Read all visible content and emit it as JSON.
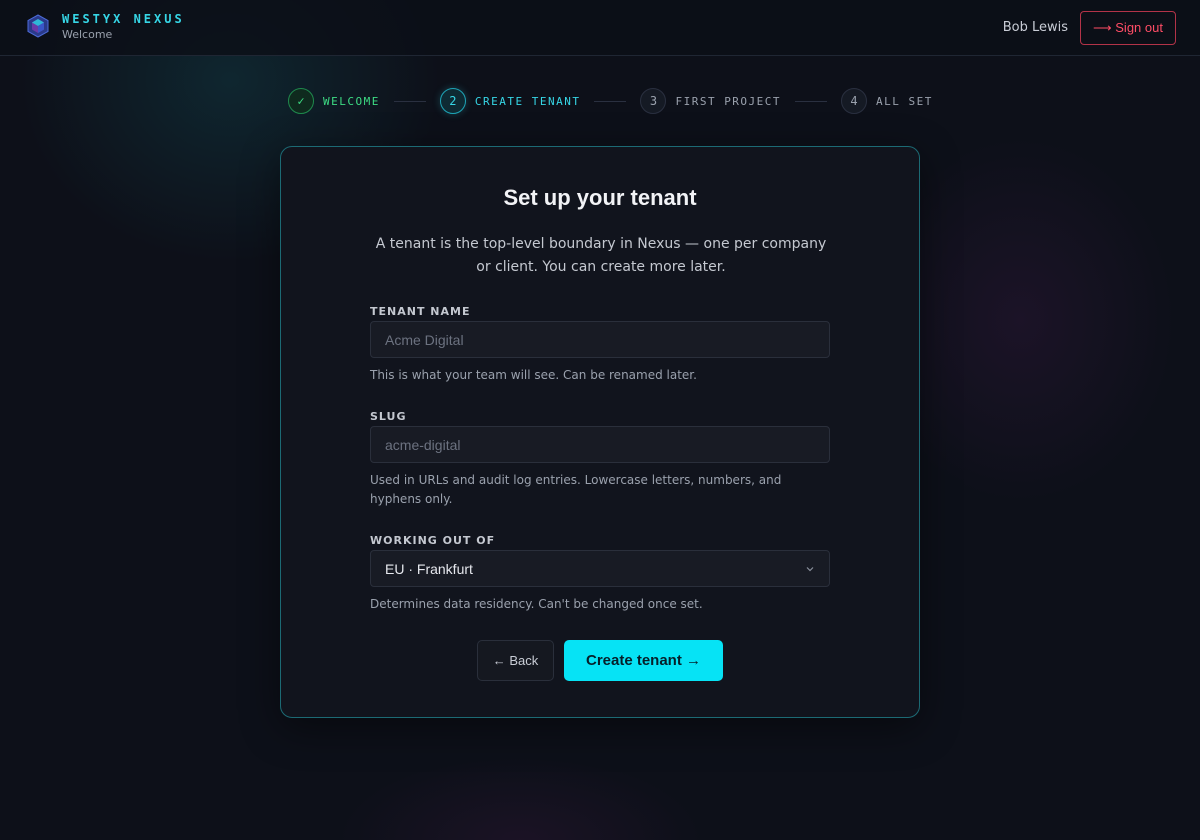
{
  "header": {
    "brand_name": "WESTYX NEXUS",
    "brand_sub": "Welcome",
    "user_name": "Bob Lewis",
    "sign_out_label": "⟶ Sign out"
  },
  "stepper": {
    "steps": [
      {
        "number": "✓",
        "label": "WELCOME",
        "state": "done"
      },
      {
        "number": "2",
        "label": "CREATE TENANT",
        "state": "active"
      },
      {
        "number": "3",
        "label": "FIRST PROJECT",
        "state": "pending"
      },
      {
        "number": "4",
        "label": "ALL SET",
        "state": "pending"
      }
    ]
  },
  "form": {
    "title": "Set up your tenant",
    "description": "A tenant is the top-level boundary in Nexus — one per company or client. You can create more later.",
    "tenant_name": {
      "label": "TENANT NAME",
      "value": "",
      "placeholder": "Acme Digital",
      "help": "This is what your team will see. Can be renamed later."
    },
    "slug": {
      "label": "SLUG",
      "value": "",
      "placeholder": "acme-digital",
      "help": "Used in URLs and audit log entries. Lowercase letters, numbers, and hyphens only."
    },
    "region": {
      "label": "WORKING OUT OF",
      "selected": "EU · Frankfurt",
      "help": "Determines data residency. Can't be changed once set."
    },
    "back_label": "← Back",
    "submit_label": "Create tenant →"
  },
  "colors": {
    "accent": "#06e3f5",
    "done": "#3ddc84",
    "danger": "#ff4d66"
  }
}
